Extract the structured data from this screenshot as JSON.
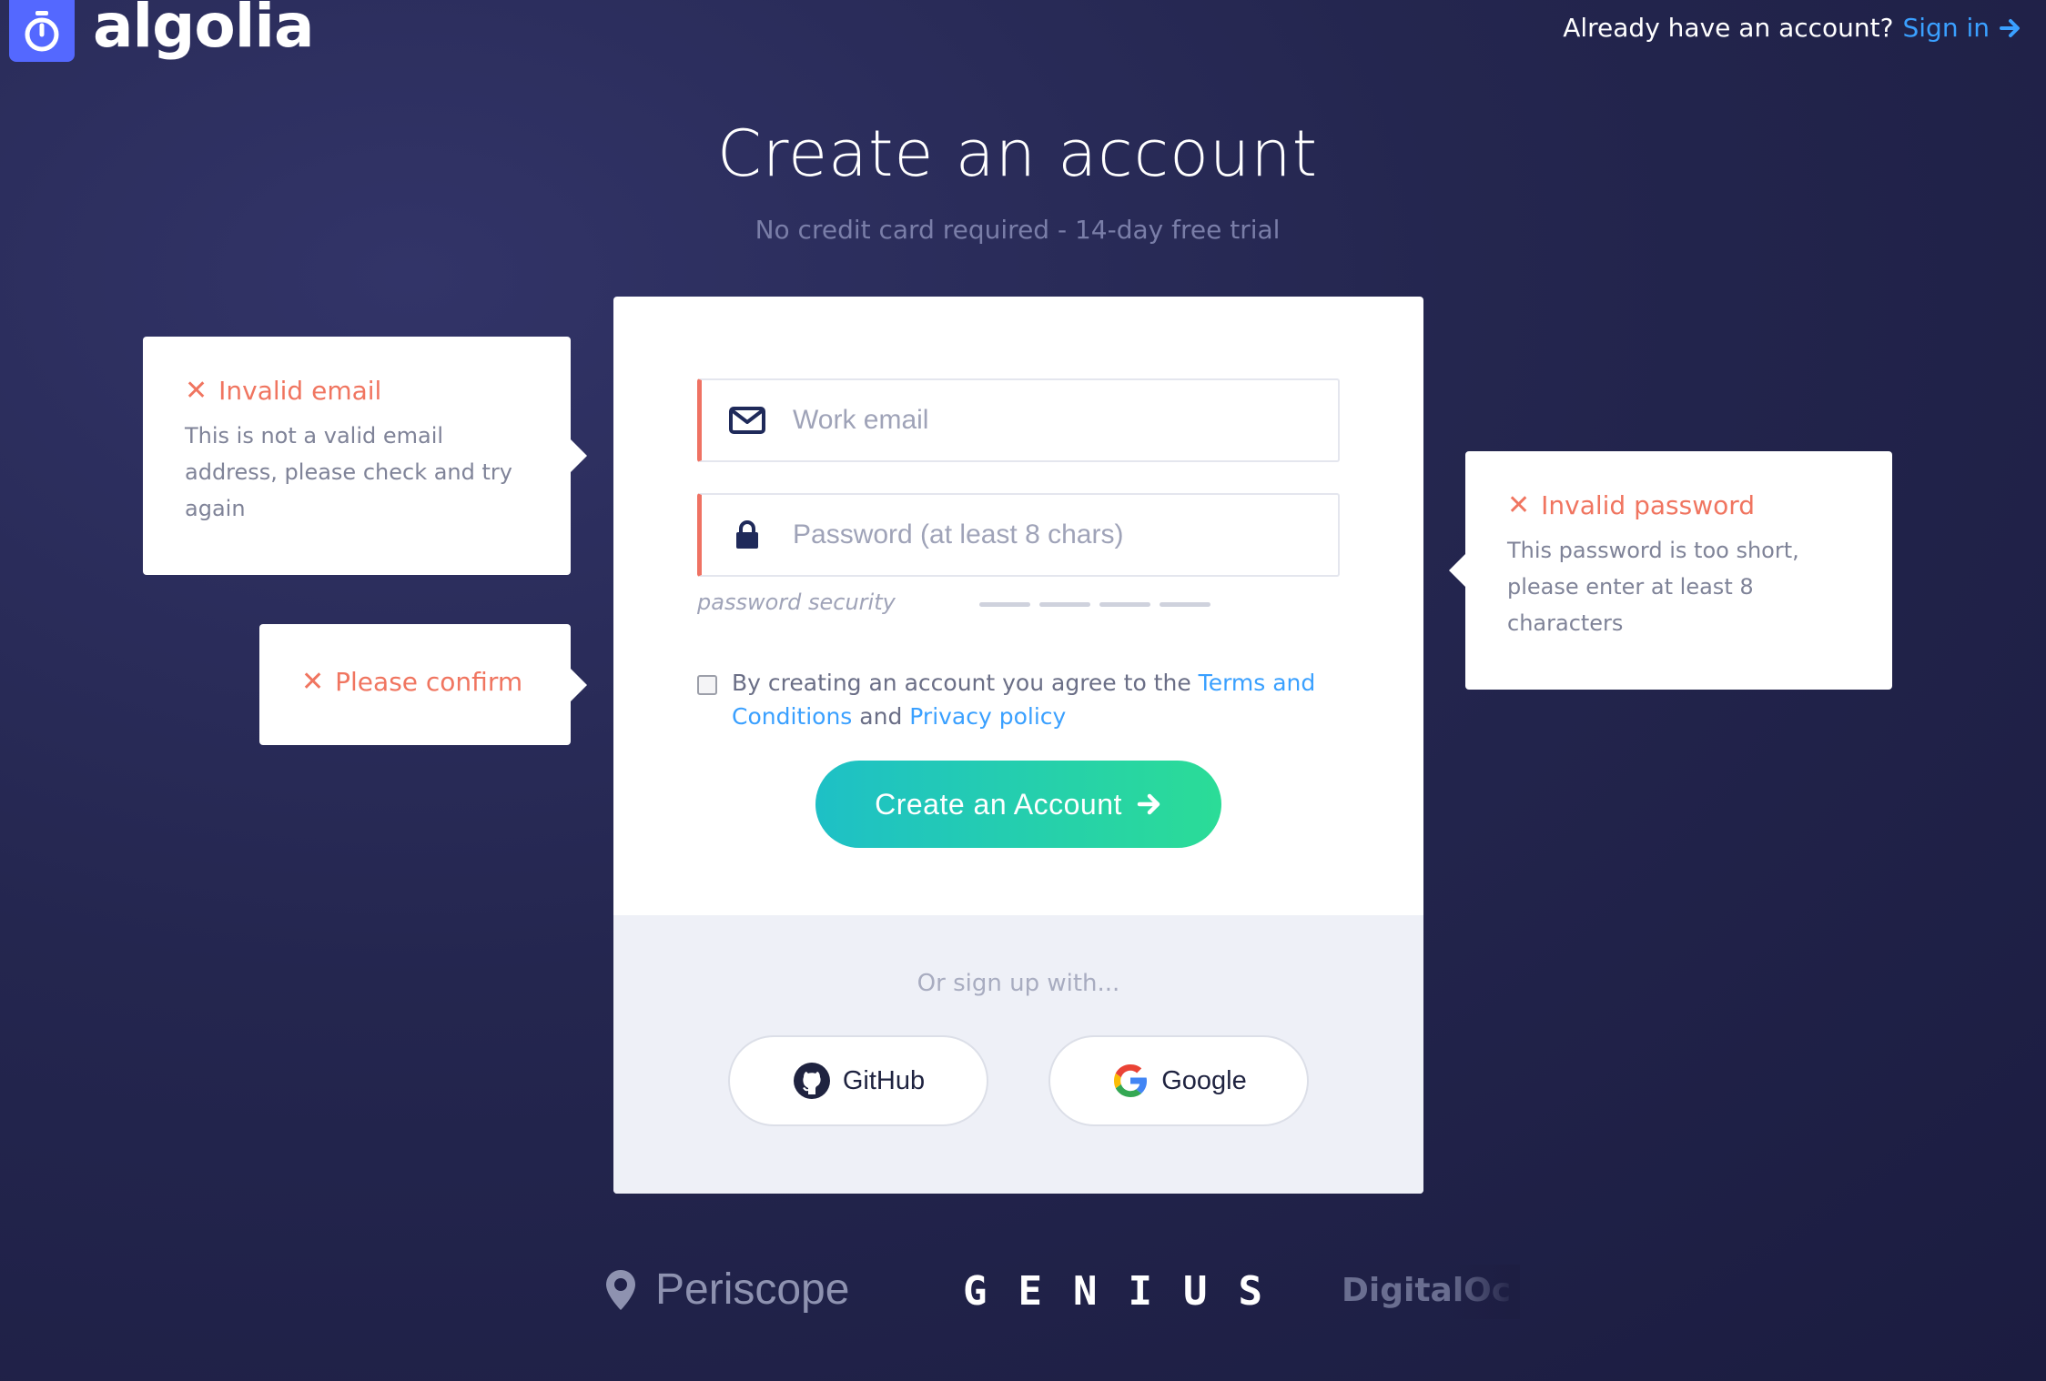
{
  "header": {
    "logo_text": "algolia",
    "signin_prompt": "Already have an account?",
    "signin_link": "Sign in"
  },
  "page": {
    "title": "Create an account",
    "subtitle": "No credit card required - 14-day free trial"
  },
  "form": {
    "email_placeholder": "Work email",
    "email_value": "",
    "password_placeholder": "Password (at least 8 chars)",
    "password_value": "",
    "password_security_label": "password security",
    "terms_prefix": "By creating an account you agree to the",
    "terms_link": "Terms and Conditions",
    "terms_and": "and",
    "privacy_link": "Privacy policy",
    "terms_checked": false,
    "submit_label": "Create an Account"
  },
  "social": {
    "or_text": "Or sign up with...",
    "github_label": "GitHub",
    "google_label": "Google"
  },
  "errors": {
    "email_title": "Invalid email",
    "email_body": "This is not a valid email address, please check and try again",
    "confirm_title": "Please confirm",
    "password_title": "Invalid password",
    "password_body": "This password is too short, please enter at least 8 characters"
  },
  "customer_logos": {
    "periscope": "Periscope",
    "genius": "GENIUS",
    "digitalocean": "DigitalOcean"
  },
  "colors": {
    "brand": "#5468ff",
    "link": "#3aa0ff",
    "error": "#f07560",
    "button_start": "#1ec0c6",
    "button_end": "#2bdc97",
    "background": "#24264f"
  },
  "icons": [
    "algolia-stopwatch-icon",
    "arrow-right-icon",
    "envelope-icon",
    "lock-icon",
    "close-icon",
    "github-icon",
    "google-icon",
    "map-pin-icon",
    "digitalocean-icon"
  ]
}
